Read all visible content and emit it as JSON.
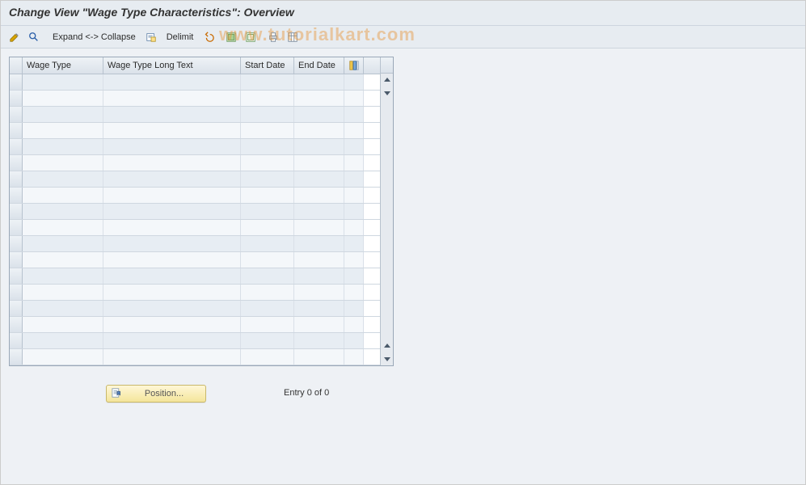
{
  "title": "Change View \"Wage Type Characteristics\": Overview",
  "toolbar": {
    "expand_collapse_label": "Expand <-> Collapse",
    "delimit_label": "Delimit"
  },
  "columns": {
    "wage_type": "Wage Type",
    "wage_type_long": "Wage Type Long Text",
    "start_date": "Start Date",
    "end_date": "End Date"
  },
  "table": {
    "row_count": 18,
    "rows": []
  },
  "footer": {
    "position_label": "Position...",
    "entry_text": "Entry 0 of 0"
  },
  "watermark": "www.tutorialkart.com"
}
